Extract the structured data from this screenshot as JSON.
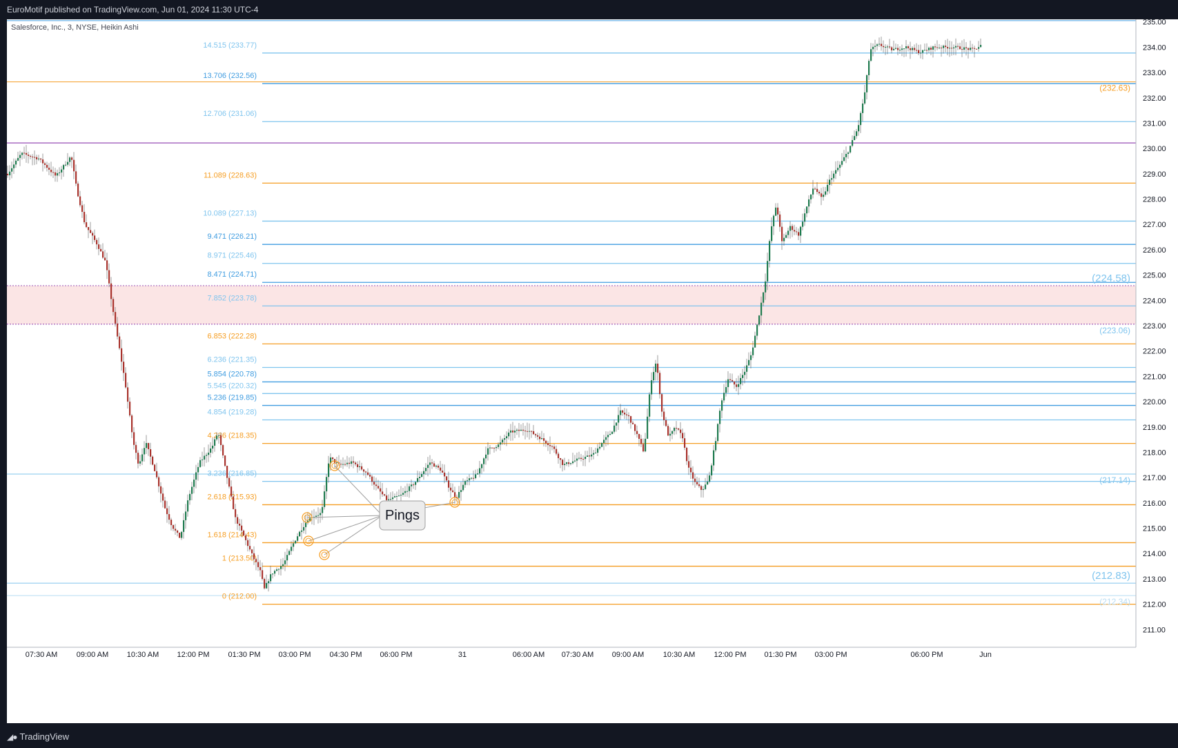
{
  "header": {
    "published_text": "EuroMotif published on TradingView.com, Jun 01, 2024 11:30 UTC-4"
  },
  "footer": {
    "brand": "TradingView",
    "logo_icon": "tradingview-logo-icon"
  },
  "chart_data": {
    "type": "candlestick",
    "symbol_label": "Salesforce, Inc., 3, NYSE, Heikin Ashi",
    "ylim": [
      210.3,
      235.1
    ],
    "y_ticks": [
      211,
      212,
      213,
      214,
      215,
      216,
      217,
      218,
      219,
      220,
      221,
      222,
      223,
      224,
      225,
      226,
      227,
      228,
      229,
      230,
      231,
      232,
      233,
      234,
      235
    ],
    "x_ticks": [
      "07:30 AM",
      "09:00 AM",
      "10:30 AM",
      "12:00 PM",
      "01:30 PM",
      "03:00 PM",
      "04:30 PM",
      "06:00 PM",
      "31",
      "06:00 AM",
      "07:30 AM",
      "09:00 AM",
      "10:30 AM",
      "12:00 PM",
      "01:30 PM",
      "03:00 PM",
      "06:00 PM",
      "Jun"
    ],
    "fib_levels": [
      {
        "label": "0 (212.00)",
        "value": 212.0,
        "color": "#f59d22"
      },
      {
        "label": "1 (213.50)",
        "value": 213.5,
        "color": "#f59d22"
      },
      {
        "label": "1.618 (214.43)",
        "value": 214.43,
        "color": "#f59d22"
      },
      {
        "label": "2.618 (215.93)",
        "value": 215.93,
        "color": "#f59d22"
      },
      {
        "label": "3.236 (216.85)",
        "value": 216.85,
        "color": "#7fc4ee"
      },
      {
        "label": "4.236 (218.35)",
        "value": 218.35,
        "color": "#f59d22"
      },
      {
        "label": "4.854 (219.28)",
        "value": 219.28,
        "color": "#7fc4ee"
      },
      {
        "label": "5.236 (219.85)",
        "value": 219.85,
        "color": "#3f9ce0"
      },
      {
        "label": "5.545 (220.32)",
        "value": 220.32,
        "color": "#7fc4ee"
      },
      {
        "label": "5.854 (220.78)",
        "value": 220.78,
        "color": "#3f9ce0"
      },
      {
        "label": "6.236 (221.35)",
        "value": 221.35,
        "color": "#7fc4ee"
      },
      {
        "label": "6.853 (222.28)",
        "value": 222.28,
        "color": "#f59d22"
      },
      {
        "label": "7.852 (223.78)",
        "value": 223.78,
        "color": "#7fc4ee"
      },
      {
        "label": "8.471 (224.71)",
        "value": 224.71,
        "color": "#3f9ce0"
      },
      {
        "label": "8.971 (225.46)",
        "value": 225.46,
        "color": "#7fc4ee"
      },
      {
        "label": "9.471 (226.21)",
        "value": 226.21,
        "color": "#3f9ce0"
      },
      {
        "label": "10.089 (227.13)",
        "value": 227.13,
        "color": "#7fc4ee"
      },
      {
        "label": "11.089 (228.63)",
        "value": 228.63,
        "color": "#f59d22"
      },
      {
        "label": "12.706 (231.06)",
        "value": 231.06,
        "color": "#7fc4ee"
      },
      {
        "label": "13.706 (232.56)",
        "value": 232.56,
        "color": "#3f9ce0"
      },
      {
        "label": "14.515 (233.77)",
        "value": 233.77,
        "color": "#7fc4ee"
      }
    ],
    "right_labels": [
      {
        "label": "(232.63)",
        "value": 232.63,
        "color": "#f59d22",
        "size": "small"
      },
      {
        "label": "(224.58)",
        "value": 224.58,
        "color": "#7fc4ee",
        "size": "large"
      },
      {
        "label": "(223.06)",
        "value": 223.06,
        "color": "#7fc4ee",
        "size": "small"
      },
      {
        "label": "(217.14)",
        "value": 217.14,
        "color": "#7fc4ee",
        "size": "small"
      },
      {
        "label": "(212.83)",
        "value": 212.83,
        "color": "#7fc4ee",
        "size": "large"
      },
      {
        "label": "(212.34)",
        "value": 212.34,
        "color": "#b8dcf2",
        "size": "small"
      }
    ],
    "horizontal_lines": [
      {
        "value": 235.05,
        "color": "#3f9ce0"
      },
      {
        "value": 232.63,
        "color": "#f59d22"
      },
      {
        "value": 230.22,
        "color": "#7b1fa2"
      },
      {
        "value": 217.14,
        "color": "#7fc4ee"
      },
      {
        "value": 212.83,
        "color": "#7fc4ee"
      },
      {
        "value": 212.34,
        "color": "#b8dcf2"
      }
    ],
    "zone": {
      "top": 224.58,
      "bottom": 223.06,
      "color": "#fbe5e5"
    },
    "annotation": {
      "text": "Pings"
    },
    "price_path": [
      [
        0,
        229.0
      ],
      [
        20,
        229.8
      ],
      [
        45,
        229.6
      ],
      [
        70,
        228.9
      ],
      [
        92,
        229.7
      ],
      [
        100,
        228.4
      ],
      [
        112,
        227.0
      ],
      [
        130,
        226.2
      ],
      [
        142,
        225.5
      ],
      [
        155,
        223.2
      ],
      [
        170,
        220.8
      ],
      [
        182,
        218.4
      ],
      [
        190,
        217.5
      ],
      [
        200,
        218.4
      ],
      [
        212,
        217.4
      ],
      [
        228,
        215.8
      ],
      [
        238,
        215.1
      ],
      [
        250,
        214.6
      ],
      [
        262,
        216.2
      ],
      [
        278,
        217.6
      ],
      [
        296,
        218.2
      ],
      [
        305,
        218.8
      ],
      [
        318,
        217.0
      ],
      [
        330,
        215.4
      ],
      [
        342,
        214.7
      ],
      [
        355,
        213.9
      ],
      [
        366,
        213.3
      ],
      [
        372,
        212.6
      ],
      [
        382,
        213.2
      ],
      [
        400,
        213.6
      ],
      [
        412,
        214.3
      ],
      [
        422,
        214.8
      ],
      [
        436,
        215.4
      ],
      [
        455,
        215.6
      ],
      [
        466,
        217.8
      ],
      [
        480,
        217.5
      ],
      [
        500,
        217.6
      ],
      [
        520,
        217.2
      ],
      [
        535,
        216.6
      ],
      [
        550,
        216.1
      ],
      [
        570,
        216.3
      ],
      [
        590,
        216.8
      ],
      [
        612,
        217.6
      ],
      [
        628,
        217.3
      ],
      [
        640,
        216.6
      ],
      [
        650,
        216.2
      ],
      [
        662,
        216.8
      ],
      [
        680,
        217.1
      ],
      [
        695,
        218.1
      ],
      [
        712,
        218.3
      ],
      [
        728,
        218.8
      ],
      [
        752,
        218.9
      ],
      [
        770,
        218.6
      ],
      [
        790,
        218.2
      ],
      [
        805,
        217.5
      ],
      [
        825,
        217.7
      ],
      [
        848,
        217.9
      ],
      [
        862,
        218.4
      ],
      [
        875,
        218.8
      ],
      [
        888,
        219.6
      ],
      [
        900,
        219.4
      ],
      [
        912,
        218.7
      ],
      [
        922,
        218.0
      ],
      [
        932,
        220.8
      ],
      [
        940,
        221.6
      ],
      [
        948,
        219.6
      ],
      [
        958,
        218.6
      ],
      [
        968,
        219.0
      ],
      [
        978,
        218.6
      ],
      [
        986,
        217.4
      ],
      [
        996,
        216.8
      ],
      [
        1006,
        216.5
      ],
      [
        1016,
        216.9
      ],
      [
        1026,
        218.5
      ],
      [
        1034,
        220.0
      ],
      [
        1044,
        220.9
      ],
      [
        1056,
        220.6
      ],
      [
        1068,
        221.2
      ],
      [
        1078,
        221.9
      ],
      [
        1088,
        223.3
      ],
      [
        1098,
        224.8
      ],
      [
        1106,
        226.8
      ],
      [
        1114,
        227.8
      ],
      [
        1122,
        226.3
      ],
      [
        1134,
        226.9
      ],
      [
        1146,
        226.6
      ],
      [
        1158,
        227.7
      ],
      [
        1168,
        228.5
      ],
      [
        1180,
        228.0
      ],
      [
        1192,
        228.8
      ],
      [
        1205,
        229.3
      ],
      [
        1218,
        229.9
      ],
      [
        1232,
        230.8
      ],
      [
        1242,
        232.2
      ],
      [
        1250,
        233.9
      ],
      [
        1262,
        234.1
      ],
      [
        1282,
        233.9
      ],
      [
        1302,
        234.0
      ],
      [
        1322,
        233.8
      ],
      [
        1342,
        234.0
      ],
      [
        1372,
        234.0
      ],
      [
        1400,
        233.9
      ],
      [
        1412,
        234.1
      ]
    ]
  }
}
